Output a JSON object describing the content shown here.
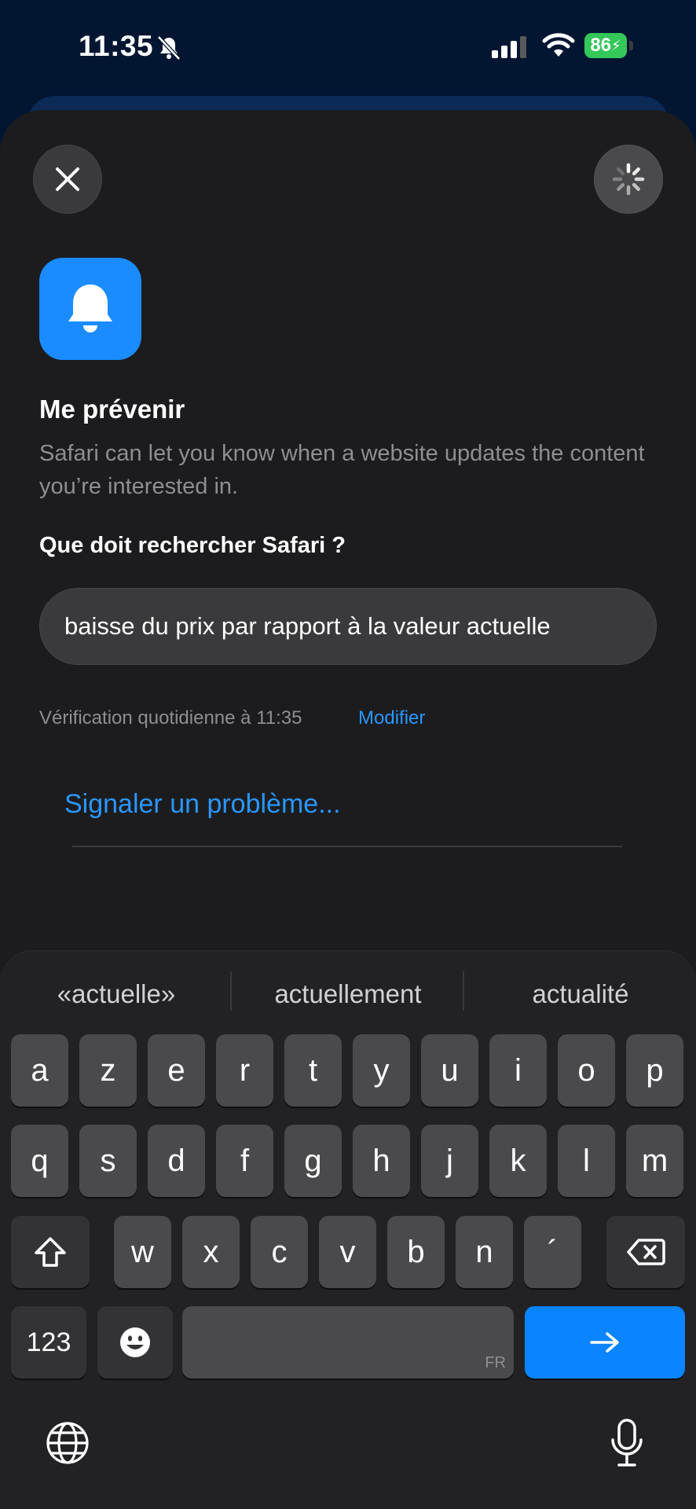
{
  "status_bar": {
    "time": "11:35",
    "battery": "86",
    "icons": [
      "bell-slash-icon",
      "cellular-signal-icon",
      "wifi-icon",
      "battery-charging-icon"
    ]
  },
  "header": {
    "close_icon": "close-icon",
    "spinner_icon": "loading-spinner-icon"
  },
  "content": {
    "app_icon": "bell-icon",
    "title": "Me prévenir",
    "description": "Safari can let you know when a website updates the content you’re interested in.",
    "question": "Que doit rechercher Safari ?",
    "search_value": "baisse du prix par rapport à la valeur actuelle",
    "check_text": "Vérification quotidienne à 11:35",
    "modify_label": "Modifier",
    "report_label": "Signaler un problème..."
  },
  "keyboard": {
    "suggestions": [
      "«actuelle»",
      "actuellement",
      "actualité"
    ],
    "row1": [
      "a",
      "z",
      "e",
      "r",
      "t",
      "y",
      "u",
      "i",
      "o",
      "p"
    ],
    "row2": [
      "q",
      "s",
      "d",
      "f",
      "g",
      "h",
      "j",
      "k",
      "l",
      "m"
    ],
    "row3": [
      "w",
      "x",
      "c",
      "v",
      "b",
      "n",
      "´"
    ],
    "numbers_label": "123",
    "space_language": "FR",
    "icons": [
      "shift-icon",
      "backspace-icon",
      "emoji-icon",
      "return-arrow-icon",
      "globe-icon",
      "microphone-icon"
    ],
    "accent_color": "#0a84ff"
  }
}
